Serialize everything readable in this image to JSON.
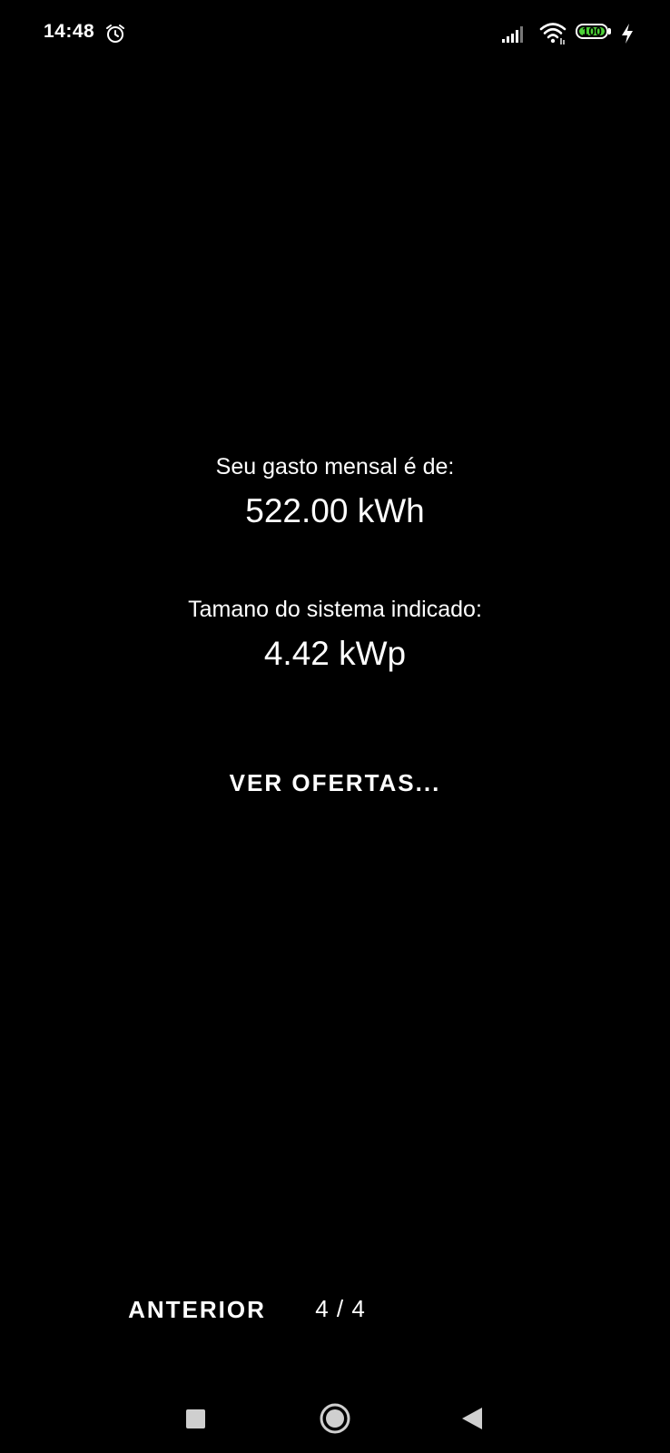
{
  "status_bar": {
    "time": "14:48",
    "battery_level": "100",
    "icons": [
      "alarm-icon",
      "signal-icon",
      "wifi-icon",
      "battery-icon",
      "charging-icon"
    ],
    "battery_color": "#4cd137"
  },
  "summary": {
    "monthly_label": "Seu gasto mensal é de:",
    "monthly_value": "522.00 kWh",
    "system_label": "Tamano do sistema indicado:",
    "system_value": "4.42 kWp"
  },
  "actions": {
    "offers_label": "VER OFERTAS...",
    "previous_label": "ANTERIOR",
    "page_indicator": "4 / 4"
  },
  "nav_bar": {
    "icons": [
      "recents-icon",
      "home-icon",
      "back-icon"
    ]
  },
  "colors": {
    "background": "#000000",
    "text": "#ffffff"
  }
}
